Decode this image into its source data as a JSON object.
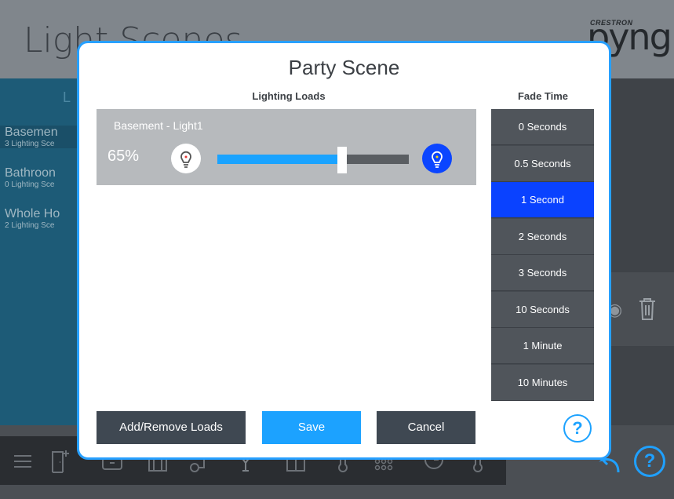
{
  "app": {
    "title": "Light Scenes",
    "brand_small": "CRESTRON",
    "brand": "pyng",
    "left_header": "L"
  },
  "rooms": [
    {
      "name": "Basemen",
      "scenes": "3 Lighting Sce"
    },
    {
      "name": "Bathroon",
      "scenes": "0 Lighting Sce"
    },
    {
      "name": "Whole Ho",
      "scenes": "2 Lighting Sce"
    }
  ],
  "bottom_nav": {
    "icons": [
      "menu-icon",
      "add-room-icon",
      "tv-icon",
      "shades-icon",
      "remote-icon",
      "lighting-icon",
      "door-icon",
      "thermometer-icon",
      "keypad-icon",
      "clock-icon",
      "temperature-sensor-icon"
    ],
    "help": "?"
  },
  "modal": {
    "title": "Party Scene",
    "loads_header": "Lighting Loads",
    "fade_header": "Fade Time",
    "load": {
      "name": "Basement - Light1",
      "level_text": "65%",
      "level": 0.65
    },
    "fade_options": [
      "0 Seconds",
      "0.5 Seconds",
      "1 Second",
      "2 Seconds",
      "3 Seconds",
      "10 Seconds",
      "1 Minute",
      "10 Minutes"
    ],
    "selected_fade": "1 Second",
    "buttons": {
      "add_remove": "Add/Remove Loads",
      "save": "Save",
      "cancel": "Cancel"
    },
    "help": "?"
  },
  "colors": {
    "accent": "#1ca2ff",
    "selected": "#0a42ff",
    "panel": "#b7babd",
    "dark_button": "#3f4852"
  }
}
